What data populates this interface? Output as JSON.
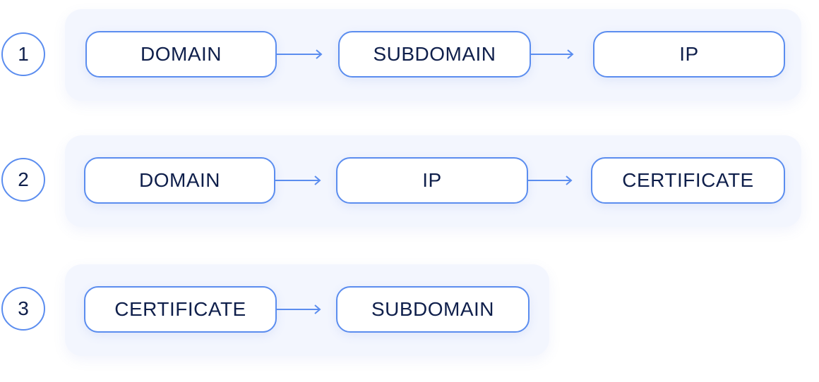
{
  "colors": {
    "border": "#5b8def",
    "text": "#0f1f4b",
    "panel": "#f3f6fe"
  },
  "rows": [
    {
      "number": "1",
      "nodes": [
        "DOMAIN",
        "SUBDOMAIN",
        "IP"
      ]
    },
    {
      "number": "2",
      "nodes": [
        "DOMAIN",
        "IP",
        "CERTIFICATE"
      ]
    },
    {
      "number": "3",
      "nodes": [
        "CERTIFICATE",
        "SUBDOMAIN"
      ]
    }
  ]
}
